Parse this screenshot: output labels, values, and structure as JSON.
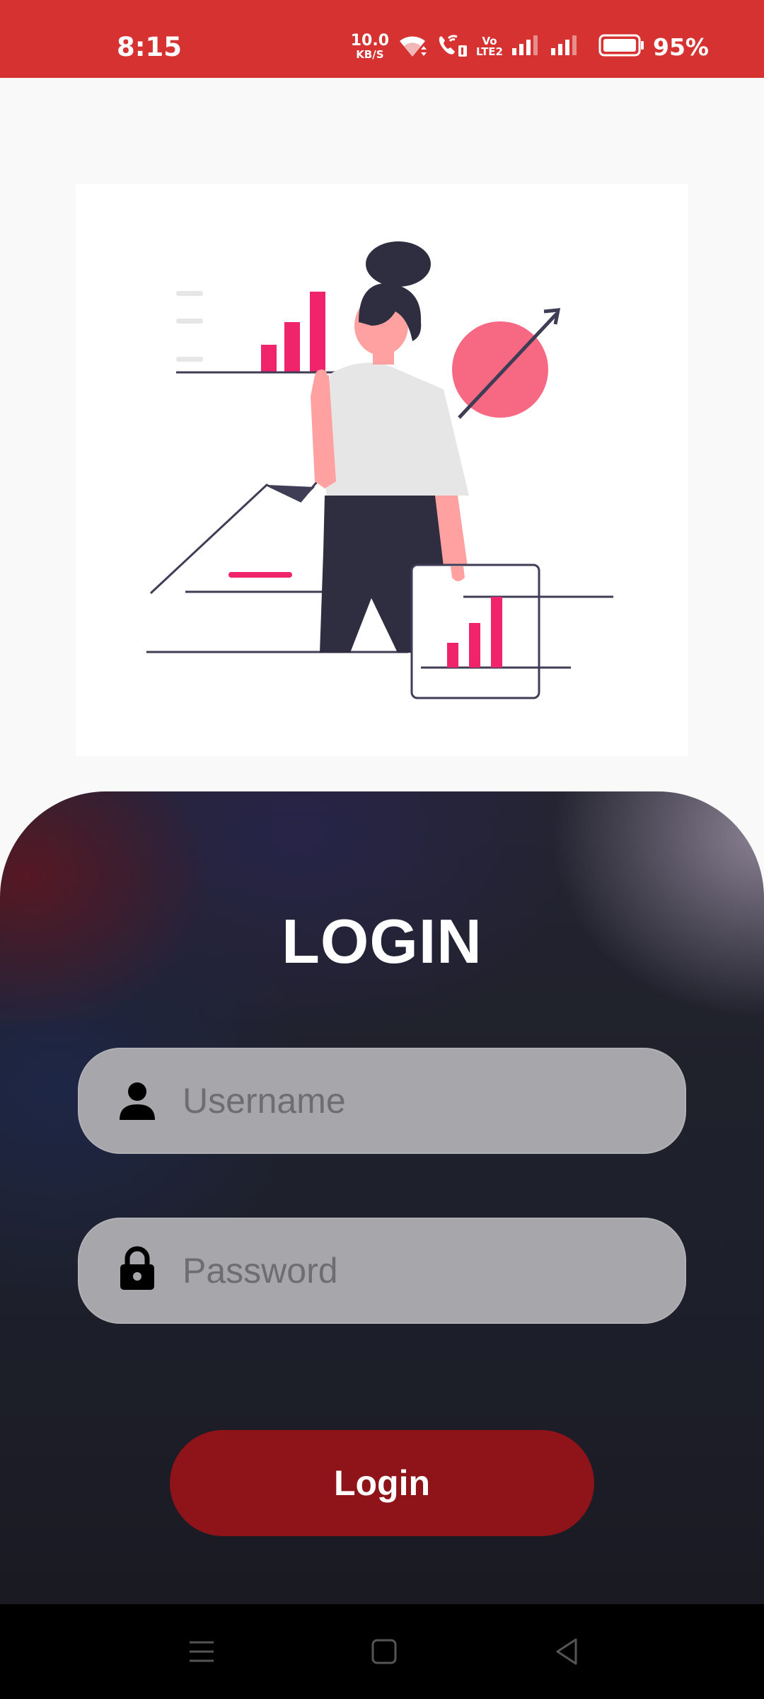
{
  "status_bar": {
    "time": "8:15",
    "net_speed_value": "10.0",
    "net_speed_unit": "KB/S",
    "volte_top": "Vo",
    "volte_bottom": "LTE2",
    "battery": "95%",
    "color": "#d63231",
    "icons": [
      "wifi-icon",
      "wifi-call-icon",
      "volte-icon",
      "signal-icon",
      "signal-icon",
      "battery-icon"
    ]
  },
  "illustration": {
    "name": "analytics-woman-illustration",
    "accent": "#f0246a",
    "circle_color": "#f76882",
    "dark": "#2f2e41"
  },
  "login": {
    "title": "LOGIN",
    "username_placeholder": "Username",
    "password_placeholder": "Password",
    "button_label": "Login",
    "button_color": "#8e141a",
    "field_icons": [
      "person-icon",
      "lock-icon"
    ]
  },
  "nav_bar": {
    "buttons": [
      "menu-icon",
      "home-icon",
      "back-icon"
    ]
  }
}
